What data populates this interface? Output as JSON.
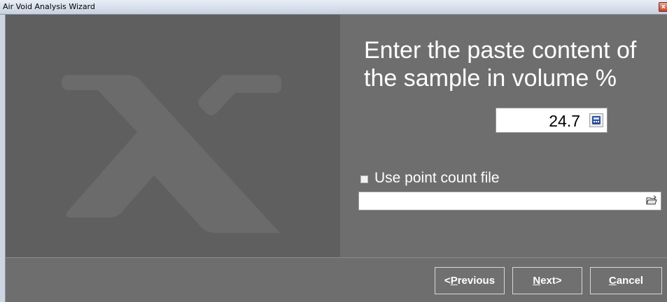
{
  "window": {
    "title": "Air Void Analysis Wizard"
  },
  "icons": {
    "close": "close-icon",
    "logo": "x-logo",
    "calculator": "calculator-icon",
    "browse": "folder-open-icon"
  },
  "content": {
    "prompt": "Enter the paste content of the sample in volume %",
    "paste_value": "24.7",
    "use_point_count_checked": false,
    "use_point_count_label": "Use point count file",
    "point_count_file_value": ""
  },
  "footer": {
    "previous": {
      "prefix": "< ",
      "mnemonic": "P",
      "rest": "revious"
    },
    "next": {
      "prefix": "",
      "mnemonic": "N",
      "rest": "ext>"
    },
    "cancel": {
      "prefix": "",
      "mnemonic": "C",
      "rest": "ancel"
    }
  },
  "colors": {
    "background": "#6e6e6e",
    "logo_panel": "#5f5f5f",
    "logo_shape": "#6b6b6b",
    "text": "#ffffff"
  }
}
